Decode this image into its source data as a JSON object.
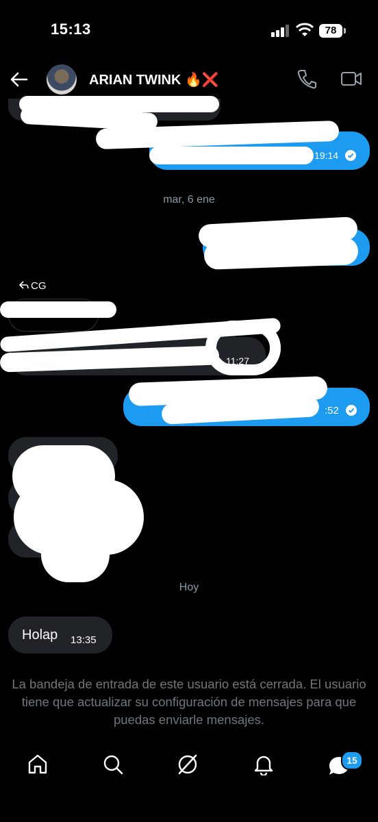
{
  "status_bar": {
    "time": "15:13",
    "battery": "78"
  },
  "header": {
    "contact_name": "ARIAN TWINK 🔥❌"
  },
  "messages": {
    "sent_1_time": "19:14",
    "date_separator_1": "mar, 6 ene",
    "reply_label": "CG",
    "received_time": "11:27",
    "sent_3_time": ":52",
    "date_separator_2": "Hoy",
    "last_message_text": "Holap",
    "last_message_time": "13:35"
  },
  "notice": "La bandeja de entrada de este usuario está cerrada. El usuario tiene que actualizar su configuración de mensajes para que puedas enviarle mensajes.",
  "nav": {
    "messages_badge": "15"
  },
  "colors": {
    "accent": "#1d9bf0",
    "bubble_gray": "#202327",
    "muted_text": "#71767b"
  }
}
